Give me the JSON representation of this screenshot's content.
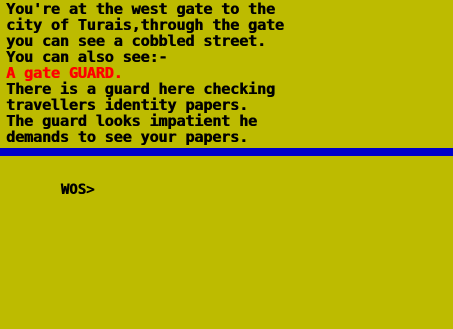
{
  "colors": {
    "background": "#bdbb00",
    "text": "#000000",
    "highlight": "#ff0000",
    "divider": "#0000c8"
  },
  "description": {
    "lines": [
      "You're at the west gate to the",
      "city of Turais,through the gate",
      "you can see a cobbled street.",
      "You can also see:-",
      "A gate GUARD.",
      "There is a guard here checking",
      "travellers identity papers.",
      "The guard looks impatient he",
      "demands to see your papers."
    ]
  },
  "input": {
    "prompt": "WOS>",
    "value": ""
  }
}
